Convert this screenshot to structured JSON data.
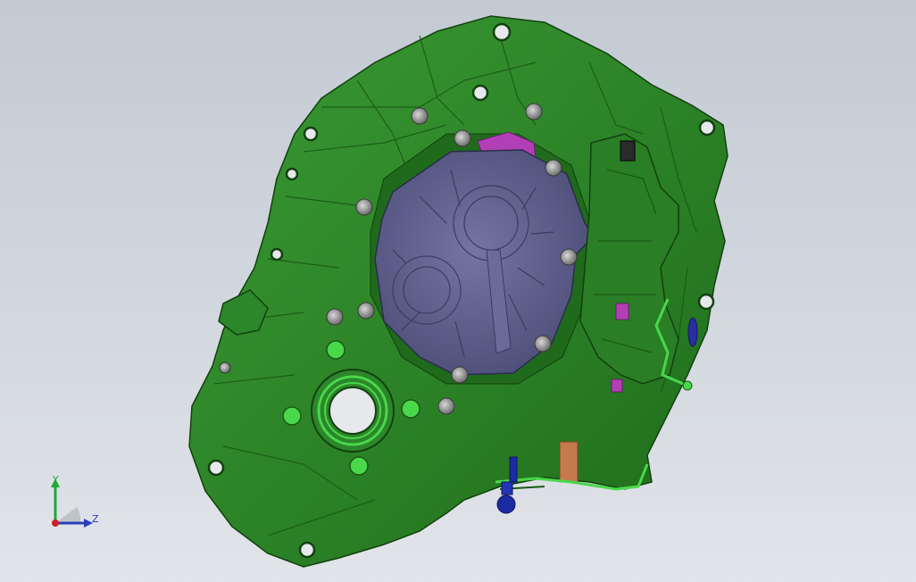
{
  "viewport": {
    "background_top": "#c3cad3",
    "background_bottom": "#e1e4e9"
  },
  "model": {
    "body_color": "#2f8a2a",
    "body_shadow_color": "#1c5a17",
    "cover_color": "#5e5f8c",
    "accent_magenta": "#b33fb6",
    "accent_blue": "#1c2aa3",
    "accent_copper": "#c57a4e",
    "highlight_green": "#49d84a"
  },
  "triad": {
    "y_label": "Y",
    "z_label": "Z",
    "y_color": "#1fa83a",
    "z_color": "#2a3fb8",
    "origin_color": "#c8202a"
  }
}
